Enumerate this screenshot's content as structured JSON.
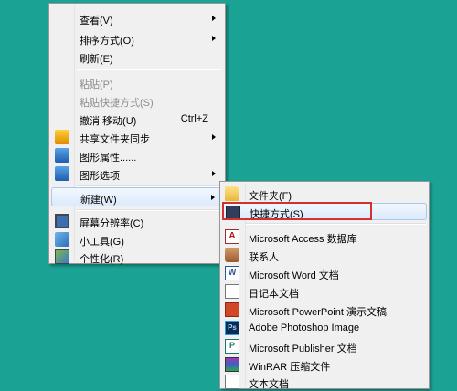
{
  "context_menu": {
    "items": [
      {
        "label": "查看(V)",
        "submenu": true
      },
      {
        "label": "排序方式(O)",
        "submenu": true
      },
      {
        "label": "刷新(E)"
      },
      {
        "label": "粘贴(P)",
        "disabled": true
      },
      {
        "label": "粘贴快捷方式(S)",
        "disabled": true
      },
      {
        "label": "撤消 移动(U)",
        "shortcut": "Ctrl+Z"
      },
      {
        "label": "共享文件夹同步",
        "submenu": true,
        "icon": "sync-folder-icon"
      },
      {
        "label": "图形属性......",
        "icon": "graphics-properties-icon"
      },
      {
        "label": "图形选项",
        "submenu": true,
        "icon": "graphics-options-icon"
      },
      {
        "label": "新建(W)",
        "submenu": true,
        "highlighted": true
      },
      {
        "label": "屏幕分辨率(C)",
        "icon": "monitor-icon"
      },
      {
        "label": "小工具(G)",
        "icon": "gadget-icon"
      },
      {
        "label": "个性化(R)",
        "icon": "personalize-icon"
      }
    ]
  },
  "new_submenu": {
    "items": [
      {
        "label": "文件夹(F)",
        "icon": "folder-icon"
      },
      {
        "label": "快捷方式(S)",
        "icon": "shortcut-icon",
        "highlighted": true
      },
      {
        "label": "Microsoft Access 数据库",
        "icon": "access-icon",
        "icon_text": "A"
      },
      {
        "label": "联系人",
        "icon": "contact-icon"
      },
      {
        "label": "Microsoft Word 文档",
        "icon": "word-icon",
        "icon_text": "W"
      },
      {
        "label": "日记本文档",
        "icon": "journal-icon"
      },
      {
        "label": "Microsoft PowerPoint 演示文稿",
        "icon": "powerpoint-icon"
      },
      {
        "label": "Adobe Photoshop Image",
        "icon": "photoshop-icon",
        "icon_text": "Ps"
      },
      {
        "label": "Microsoft Publisher 文档",
        "icon": "publisher-icon",
        "icon_text": "P"
      },
      {
        "label": "WinRAR 压缩文件",
        "icon": "winrar-icon"
      },
      {
        "label": "文本文档",
        "icon": "text-document-icon"
      }
    ]
  },
  "colors": {
    "desktop": "#1aa294",
    "menu_bg": "#f0f0f0",
    "highlight_border": "#a8c8ec",
    "annotation_red": "#d33030"
  }
}
